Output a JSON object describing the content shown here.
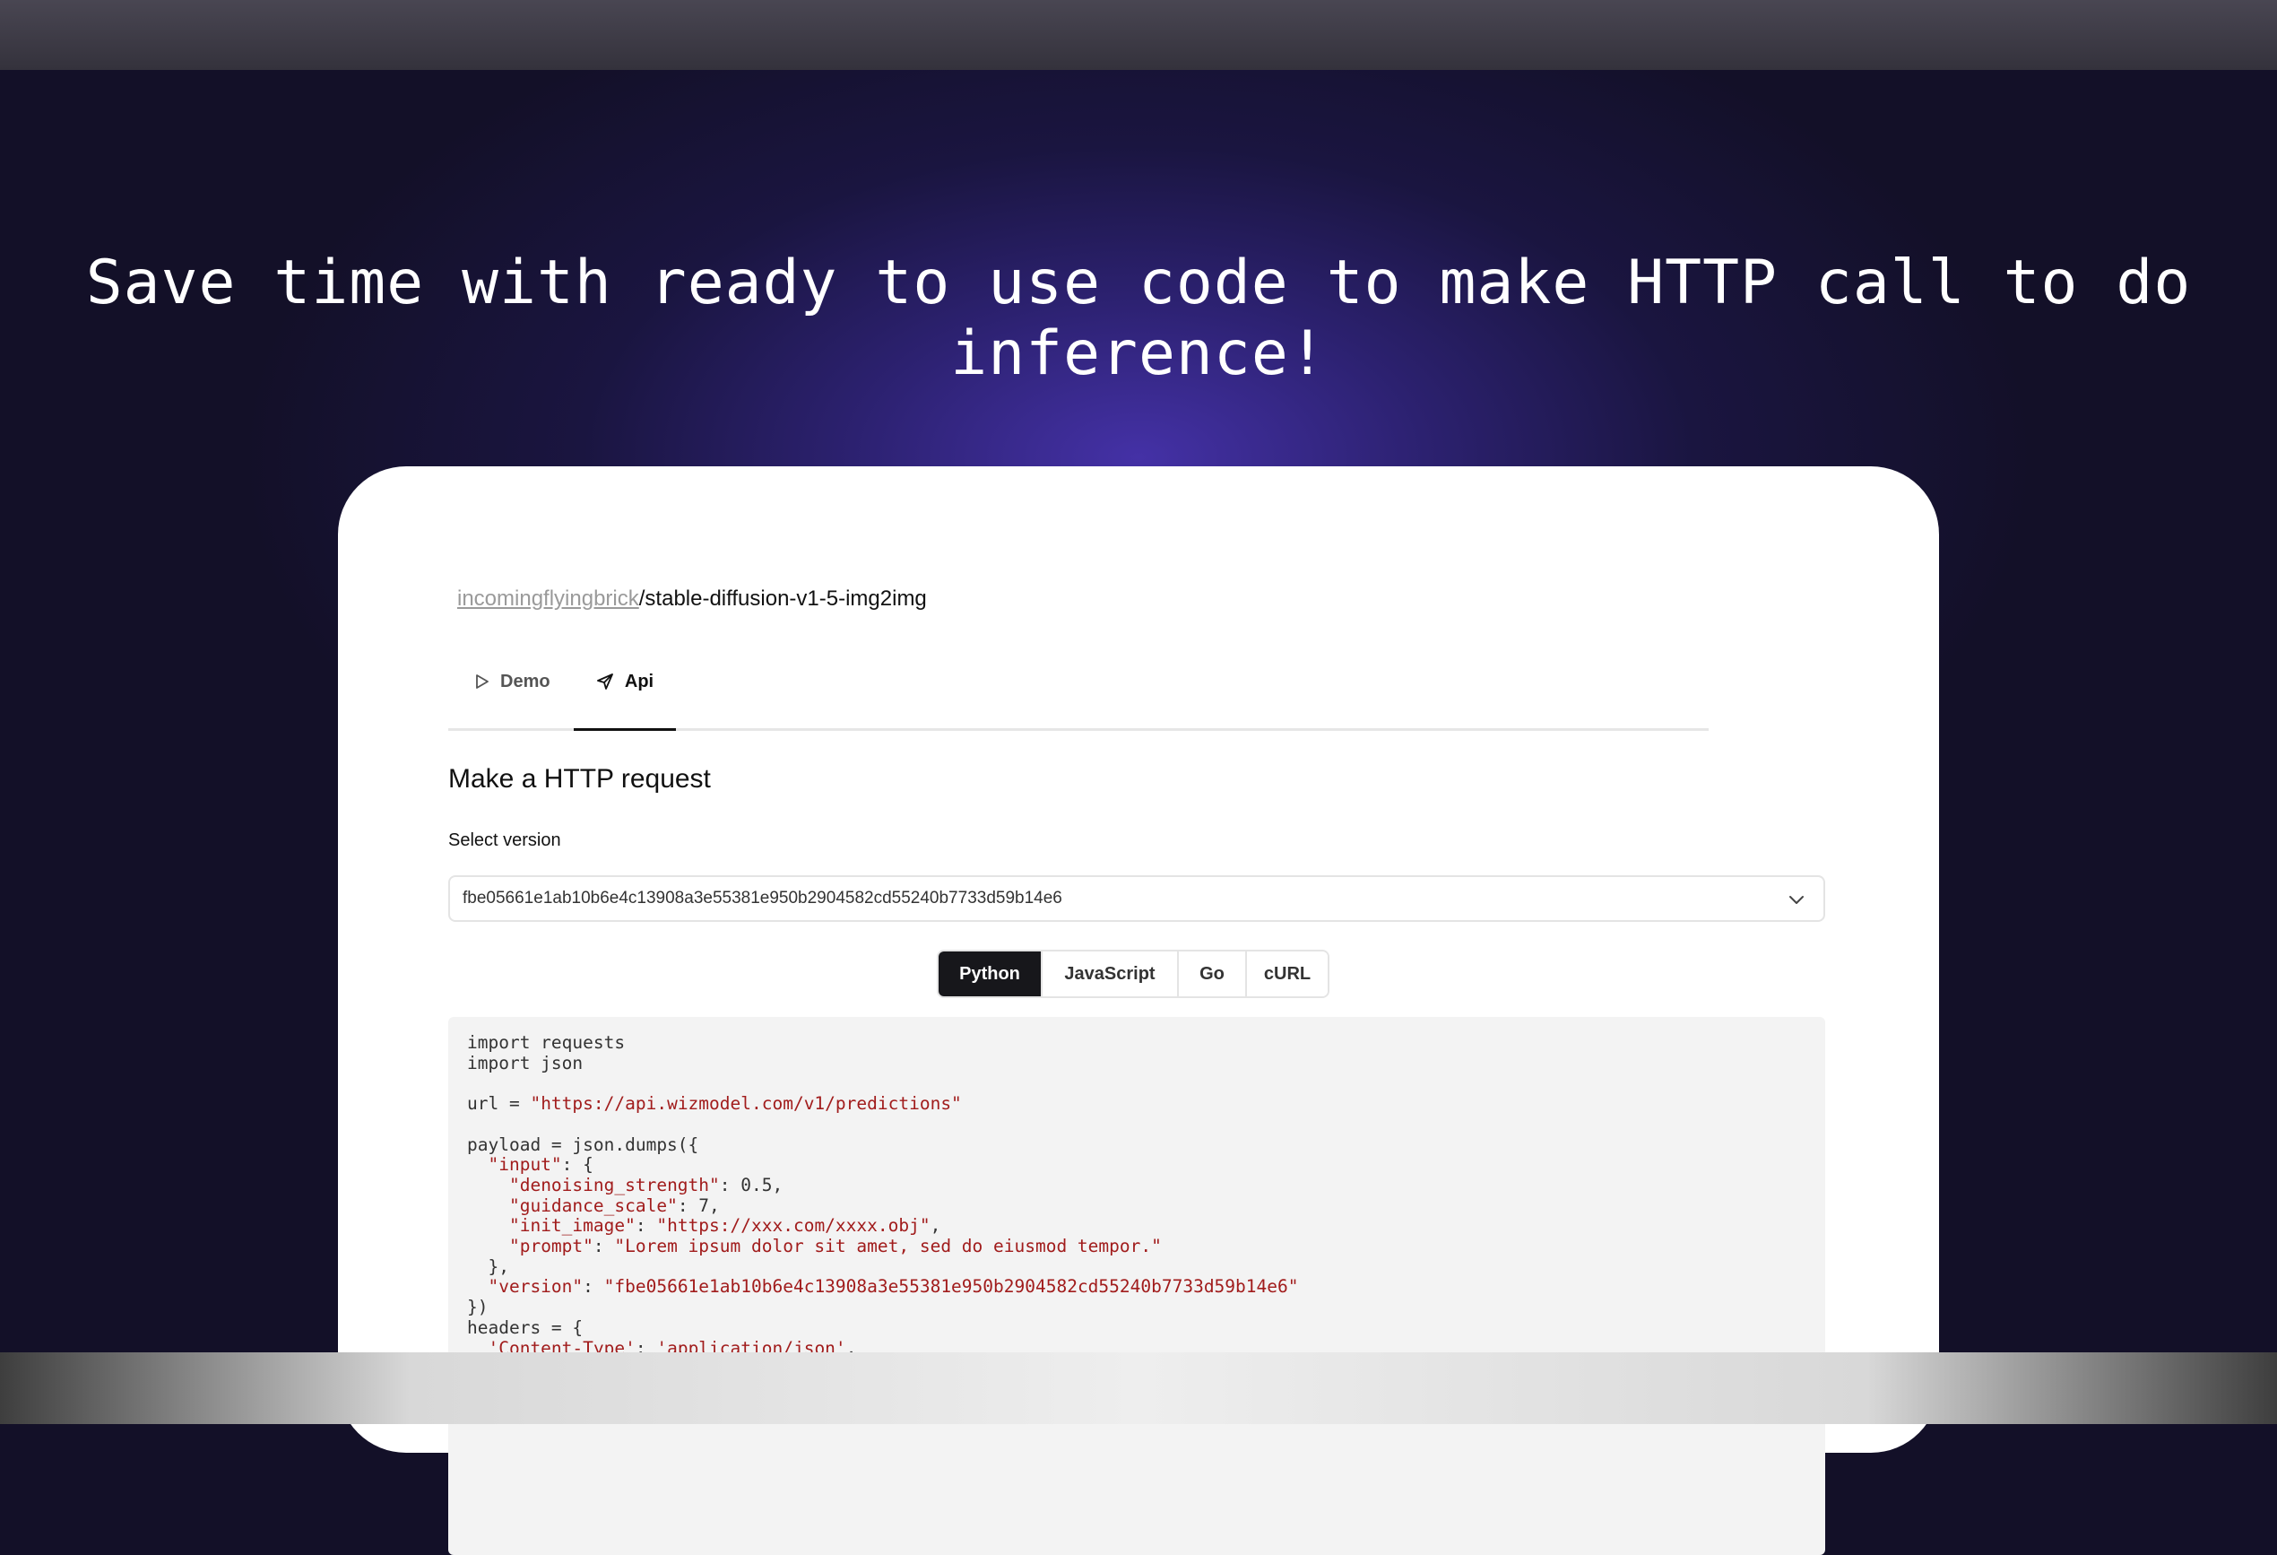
{
  "headline": "Save time with ready to use code to make HTTP call to do inference!",
  "breadcrumb": {
    "owner": "incomingflyingbrick",
    "separator": "/",
    "model": "stable-diffusion-v1-5-img2img"
  },
  "tabs": [
    {
      "label": "Demo",
      "icon": "play-icon",
      "active": false
    },
    {
      "label": "Api",
      "icon": "send-icon",
      "active": true
    }
  ],
  "section_title": "Make a HTTP request",
  "select_version": {
    "label": "Select version",
    "value": "fbe05661e1ab10b6e4c13908a3e55381e950b2904582cd55240b7733d59b14e6",
    "icon": "chevron-down-icon"
  },
  "languages": [
    {
      "label": "Python",
      "active": true
    },
    {
      "label": "JavaScript",
      "active": false
    },
    {
      "label": "Go",
      "active": false
    },
    {
      "label": "cURL",
      "active": false
    }
  ],
  "code": {
    "l1": "import requests",
    "l2": "import json",
    "l4a": "url = ",
    "l4b": "\"https://api.wizmodel.com/v1/predictions\"",
    "l6": "payload = json.dumps({",
    "l7a": "  ",
    "l7b": "\"input\"",
    "l7c": ": {",
    "l8a": "    ",
    "l8b": "\"denoising_strength\"",
    "l8c": ": 0.5,",
    "l9a": "    ",
    "l9b": "\"guidance_scale\"",
    "l9c": ": 7,",
    "l10a": "    ",
    "l10b": "\"init_image\"",
    "l10c": ": ",
    "l10d": "\"https://xxx.com/xxxx.obj\"",
    "l10e": ",",
    "l11a": "    ",
    "l11b": "\"prompt\"",
    "l11c": ": ",
    "l11d": "\"Lorem ipsum dolor sit amet, sed do eiusmod tempor.\"",
    "l12": "  },",
    "l13a": "  ",
    "l13b": "\"version\"",
    "l13c": ": ",
    "l13d": "\"fbe05661e1ab10b6e4c13908a3e55381e950b2904582cd55240b7733d59b14e6\"",
    "l14": "})",
    "l15": "headers = {",
    "l16a": "  ",
    "l16b": "'Content-Type'",
    "l16c": ": ",
    "l16d": "'application/json'",
    "l16e": ","
  }
}
